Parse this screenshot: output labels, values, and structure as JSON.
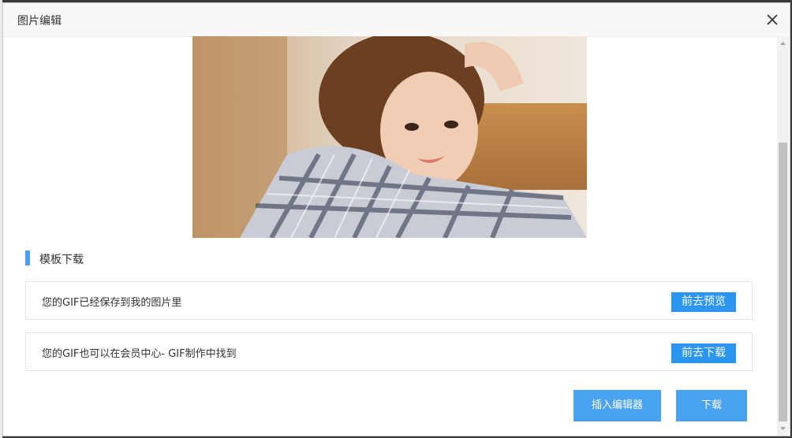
{
  "dialog": {
    "title": "图片编辑"
  },
  "section": {
    "label": "模板下载"
  },
  "rows": [
    {
      "text": "您的GIF已经保存到我的图片里",
      "button": "前去预览"
    },
    {
      "text": "您的GIF也可以在会员中心- GIF制作中找到",
      "button": "前去下载"
    }
  ],
  "footer": {
    "insert_label": "插入编辑器",
    "download_label": "下载"
  },
  "colors": {
    "accent": "#2b95f0",
    "button_light": "#4aa3f2",
    "section_bar": "#4a9ff5"
  },
  "icons": {
    "close": "close-icon",
    "photo": "gif-preview-image"
  }
}
